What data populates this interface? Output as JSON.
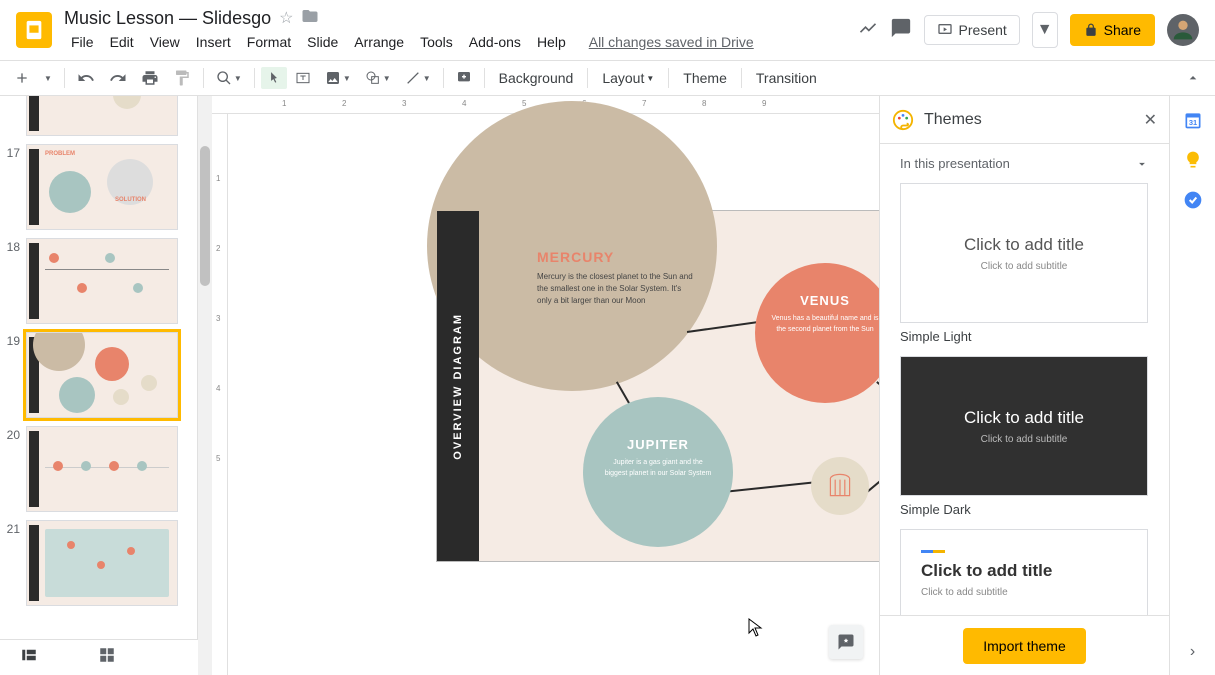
{
  "doc": {
    "title": "Music Lesson — Slidesgo"
  },
  "menu": [
    "File",
    "Edit",
    "View",
    "Insert",
    "Format",
    "Slide",
    "Arrange",
    "Tools",
    "Add-ons",
    "Help"
  ],
  "save_status": "All changes saved in Drive",
  "header": {
    "present": "Present",
    "share": "Share"
  },
  "toolbar": {
    "background": "Background",
    "layout": "Layout",
    "theme": "Theme",
    "transition": "Transition"
  },
  "filmstrip": {
    "visible_numbers": [
      "17",
      "18",
      "19",
      "20",
      "21"
    ],
    "selected": 19
  },
  "slide": {
    "overview_label": "OVERVIEW DIAGRAM",
    "mercury": {
      "title": "MERCURY",
      "body": "Mercury is the closest planet to the Sun and the smallest one in the Solar System. It's only a bit larger than our Moon"
    },
    "venus": {
      "title": "VENUS",
      "body": "Venus has a beautiful name and is the second planet from the Sun"
    },
    "jupiter": {
      "title": "JUPITER",
      "body": "Jupiter is a gas giant and the biggest planet in our Solar System"
    }
  },
  "themes": {
    "title": "Themes",
    "section": "In this presentation",
    "placeholder_title": "Click to add title",
    "placeholder_sub": "Click to add subtitle",
    "simple_light": "Simple Light",
    "simple_dark": "Simple Dark",
    "import": "Import theme"
  },
  "ruler_h": [
    "1",
    "2",
    "3",
    "4",
    "5",
    "6",
    "7",
    "8",
    "9"
  ],
  "ruler_v": [
    "1",
    "2",
    "3",
    "4",
    "5"
  ]
}
